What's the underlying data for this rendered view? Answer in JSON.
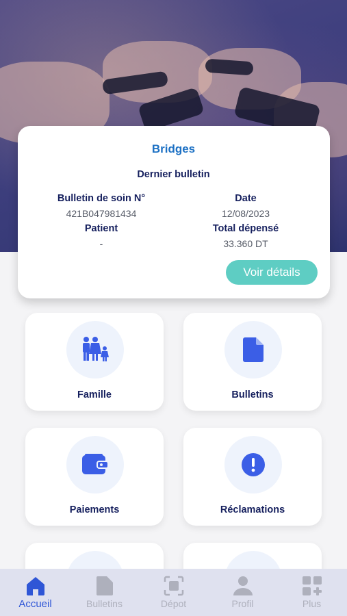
{
  "colors": {
    "brand": "#1d71c4",
    "title_navy": "#16205e",
    "accent_teal": "#5ecdc3",
    "icon_blue": "#3b5ee6",
    "tab_active": "#2f56d6",
    "tab_inactive": "#aeb0bc"
  },
  "summary": {
    "brand": "Bridges",
    "title": "Dernier bulletin",
    "bulletin_label": "Bulletin de soin N°",
    "bulletin_value": "421B047981434",
    "date_label": "Date",
    "date_value": "12/08/2023",
    "patient_label": "Patient",
    "patient_value": "-",
    "total_label": "Total dépensé",
    "total_value": "33.360 DT",
    "details_button": "Voir détails"
  },
  "menu": {
    "famille": {
      "label": "Famille",
      "icon": "family-icon"
    },
    "bulletins": {
      "label": "Bulletins",
      "icon": "document-icon"
    },
    "paiements": {
      "label": "Paiements",
      "icon": "wallet-icon"
    },
    "reclamations": {
      "label": "Réclamations",
      "icon": "alert-icon"
    }
  },
  "tabbar": {
    "accueil": {
      "label": "Accueil",
      "icon": "home-icon",
      "active": true
    },
    "bulletins": {
      "label": "Bulletins",
      "icon": "document-icon"
    },
    "depot": {
      "label": "Dépot",
      "icon": "scan-icon"
    },
    "profil": {
      "label": "Profil",
      "icon": "user-icon"
    },
    "plus": {
      "label": "Plus",
      "icon": "grid-plus-icon"
    }
  }
}
